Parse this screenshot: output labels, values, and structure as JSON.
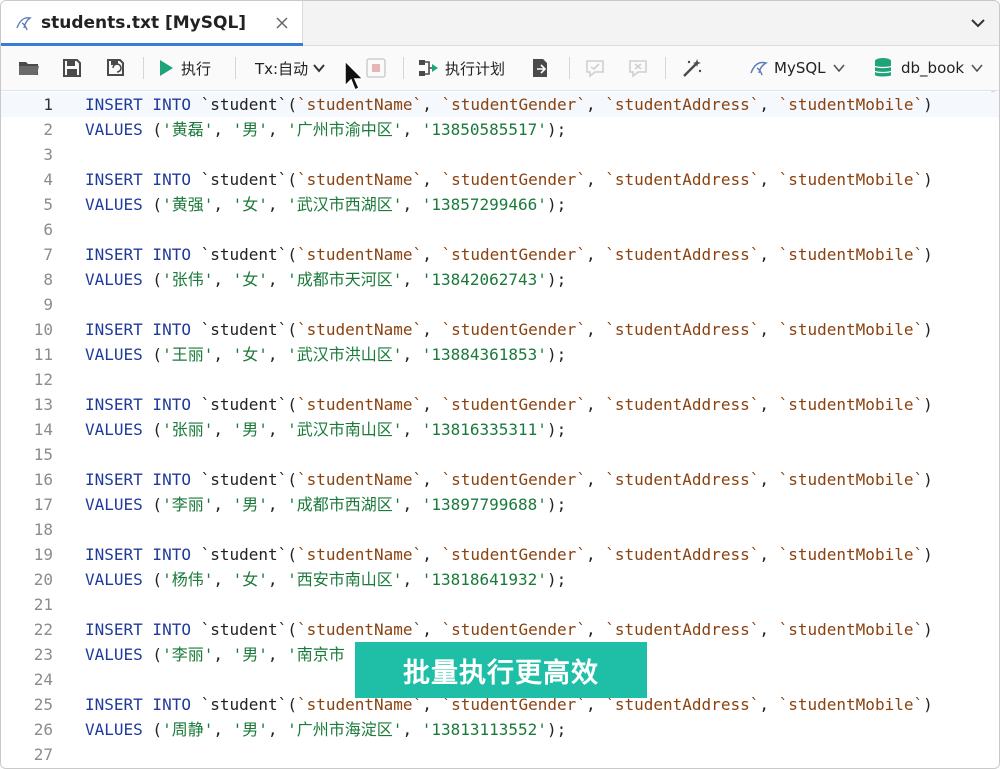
{
  "tab": {
    "title": "students.txt [MySQL]"
  },
  "toolbar": {
    "execute_label": "执行",
    "tx_label": "Tx:自动",
    "plan_label": "执行计划",
    "db_type_label": "MySQL",
    "database_label": "db_book"
  },
  "colors": {
    "accent": "#3a7bd5",
    "banner": "#1ebfa6",
    "keyword": "#1f3a9b",
    "column": "#8a4210",
    "string": "#1a7a3a"
  },
  "editor": {
    "current_line": 1,
    "lines": [
      {
        "num": "1",
        "kind": "insert"
      },
      {
        "num": "2",
        "kind": "values",
        "name": "'黄磊'",
        "gender": "'男'",
        "address": "'广州市渝中区'",
        "mobile": "'13850585517'"
      },
      {
        "num": "3",
        "kind": "blank"
      },
      {
        "num": "4",
        "kind": "insert"
      },
      {
        "num": "5",
        "kind": "values",
        "name": "'黄强'",
        "gender": "'女'",
        "address": "'武汉市西湖区'",
        "mobile": "'13857299466'"
      },
      {
        "num": "6",
        "kind": "blank"
      },
      {
        "num": "7",
        "kind": "insert"
      },
      {
        "num": "8",
        "kind": "values",
        "name": "'张伟'",
        "gender": "'女'",
        "address": "'成都市天河区'",
        "mobile": "'13842062743'"
      },
      {
        "num": "9",
        "kind": "blank"
      },
      {
        "num": "10",
        "kind": "insert"
      },
      {
        "num": "11",
        "kind": "values",
        "name": "'王丽'",
        "gender": "'女'",
        "address": "'武汉市洪山区'",
        "mobile": "'13884361853'"
      },
      {
        "num": "12",
        "kind": "blank"
      },
      {
        "num": "13",
        "kind": "insert"
      },
      {
        "num": "14",
        "kind": "values",
        "name": "'张丽'",
        "gender": "'男'",
        "address": "'武汉市南山区'",
        "mobile": "'13816335311'"
      },
      {
        "num": "15",
        "kind": "blank"
      },
      {
        "num": "16",
        "kind": "insert"
      },
      {
        "num": "17",
        "kind": "values",
        "name": "'李丽'",
        "gender": "'男'",
        "address": "'成都市西湖区'",
        "mobile": "'13897799688'"
      },
      {
        "num": "18",
        "kind": "blank"
      },
      {
        "num": "19",
        "kind": "insert"
      },
      {
        "num": "20",
        "kind": "values",
        "name": "'杨伟'",
        "gender": "'女'",
        "address": "'西安市南山区'",
        "mobile": "'13818641932'"
      },
      {
        "num": "21",
        "kind": "blank"
      },
      {
        "num": "22",
        "kind": "insert"
      },
      {
        "num": "23",
        "kind": "values_partial",
        "name": "'李丽'",
        "gender": "'男'",
        "address": "'南京市"
      },
      {
        "num": "24",
        "kind": "blank"
      },
      {
        "num": "25",
        "kind": "insert"
      },
      {
        "num": "26",
        "kind": "values",
        "name": "'周静'",
        "gender": "'男'",
        "address": "'广州市海淀区'",
        "mobile": "'13813113552'"
      },
      {
        "num": "27",
        "kind": "blank"
      }
    ],
    "sql": {
      "insert_kw": "INSERT INTO",
      "table": "`student`",
      "columns": [
        "`studentName`",
        "`studentGender`",
        "`studentAddress`",
        "`studentMobile`"
      ],
      "values_kw": "VALUES"
    }
  },
  "banner": {
    "text": "批量执行更高效"
  }
}
